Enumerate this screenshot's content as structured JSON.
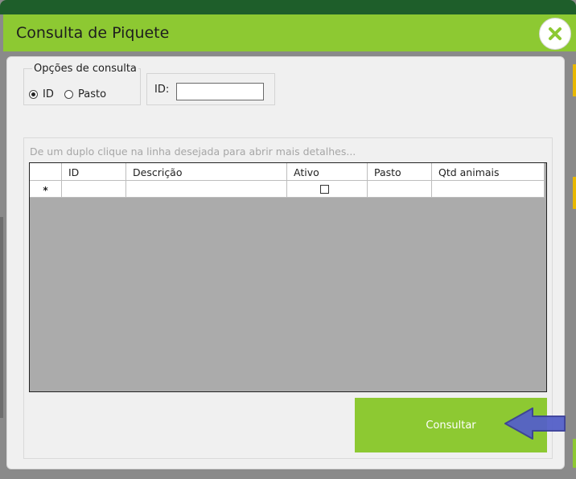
{
  "window": {
    "title": "Consulta de Piquete"
  },
  "search_options": {
    "legend": "Opções de consulta",
    "radio_id_label": "ID",
    "radio_pasto_label": "Pasto",
    "selected": "ID"
  },
  "id_filter": {
    "label": "ID:",
    "value": ""
  },
  "grid": {
    "hint": "De um duplo clique na linha desejada para abrir mais detalhes...",
    "columns": [
      "ID",
      "Descrição",
      "Ativo",
      "Pasto",
      "Qtd animais"
    ],
    "new_row_marker": "*",
    "rows": []
  },
  "actions": {
    "consultar_label": "Consultar"
  },
  "icons": {
    "close": "close-icon",
    "pointer": "arrow-left-icon"
  },
  "colors": {
    "accent": "#8dc932",
    "header_dark": "#1e5e2a",
    "grid_empty": "#ababab",
    "arrow": "#5560c8"
  }
}
